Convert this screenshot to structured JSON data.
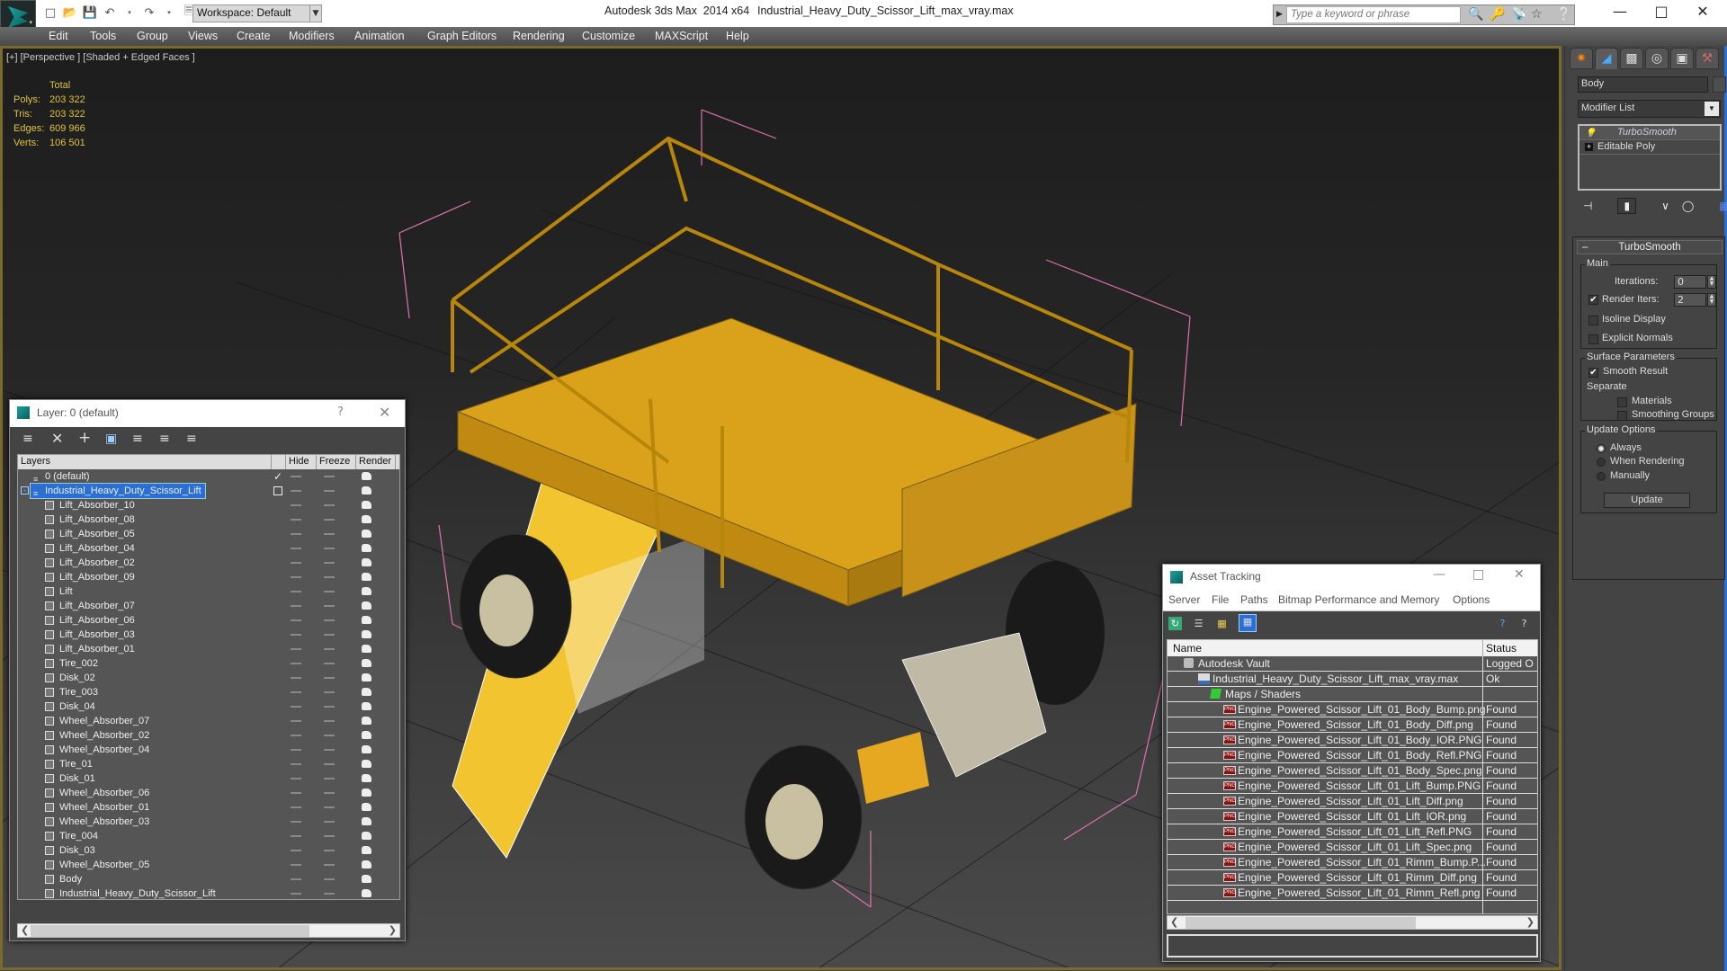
{
  "titlebar": {
    "app_title": "Autodesk 3ds Max  2014 x64",
    "file_name": "Industrial_Heavy_Duty_Scissor_Lift_max_vray.max",
    "workspace": "Workspace: Default",
    "search_placeholder": "Type a keyword or phrase",
    "quick_access_icons": [
      "new-file-icon",
      "open-folder-icon",
      "save-icon",
      "undo-icon",
      "redo-icon",
      "project-folder-icon"
    ],
    "info_icons": [
      "binoculars-icon",
      "key-icon",
      "satellite-icon",
      "star-icon",
      "help-icon"
    ]
  },
  "menubar": [
    "Edit",
    "Tools",
    "Group",
    "Views",
    "Create",
    "Modifiers",
    "Animation",
    "Graph Editors",
    "Rendering",
    "Customize",
    "MAXScript",
    "Help"
  ],
  "viewport": {
    "label": "[+] [Perspective ] [Shaded + Edged Faces ]",
    "stats": {
      "header": "Total",
      "rows": [
        {
          "key": "Polys:",
          "value": "203 322"
        },
        {
          "key": "Tris:",
          "value": "203 322"
        },
        {
          "key": "Edges:",
          "value": "609 966"
        },
        {
          "key": "Verts:",
          "value": "106 501"
        }
      ]
    }
  },
  "command_panel": {
    "tabs": [
      "create-tab",
      "modify-tab",
      "hierarchy-tab",
      "motion-tab",
      "display-tab",
      "utilities-tab"
    ],
    "object_name": "Body",
    "modifier_list": "Modifier List",
    "stack": [
      "TurboSmooth",
      "Editable Poly"
    ],
    "rollout_title": "TurboSmooth",
    "main_group": "Main",
    "iterations_label": "Iterations:",
    "iterations_value": "0",
    "render_iters_label": "Render Iters:",
    "render_iters_value": "2",
    "render_iters_checked": true,
    "isoline_label": "Isoline Display",
    "isoline_checked": false,
    "explicit_label": "Explicit Normals",
    "explicit_checked": false,
    "surface_group": "Surface Parameters",
    "smooth_result_label": "Smooth Result",
    "smooth_result_checked": true,
    "separate_label": "Separate",
    "materials_label": "Materials",
    "materials_checked": false,
    "smoothing_groups_label": "Smoothing Groups",
    "smoothing_groups_checked": false,
    "update_group": "Update Options",
    "update_options": [
      "Always",
      "When Rendering",
      "Manually"
    ],
    "update_selected": "Always",
    "update_button": "Update"
  },
  "layer_dialog": {
    "title": "Layer: 0 (default)",
    "help": "?",
    "columns": [
      "Layers",
      "",
      "Hide",
      "Freeze",
      "Render"
    ],
    "layers": [
      {
        "name": "0 (default)",
        "type": "layer",
        "current": true,
        "selected": false
      },
      {
        "name": "Industrial_Heavy_Duty_Scissor_Lift",
        "type": "layer",
        "current": false,
        "selected": true,
        "expanded": true
      }
    ],
    "objects": [
      "Lift_Absorber_10",
      "Lift_Absorber_08",
      "Lift_Absorber_05",
      "Lift_Absorber_04",
      "Lift_Absorber_02",
      "Lift_Absorber_09",
      "Lift",
      "Lift_Absorber_07",
      "Lift_Absorber_06",
      "Lift_Absorber_03",
      "Lift_Absorber_01",
      "Tire_002",
      "Disk_02",
      "Tire_003",
      "Disk_04",
      "Wheel_Absorber_07",
      "Wheel_Absorber_02",
      "Wheel_Absorber_04",
      "Tire_01",
      "Disk_01",
      "Wheel_Absorber_06",
      "Wheel_Absorber_01",
      "Wheel_Absorber_03",
      "Tire_004",
      "Disk_03",
      "Wheel_Absorber_05",
      "Body",
      "Industrial_Heavy_Duty_Scissor_Lift"
    ]
  },
  "asset_tracking": {
    "title": "Asset Tracking",
    "menu": [
      "Server",
      "File",
      "Paths",
      "Bitmap Performance and Memory",
      "Options"
    ],
    "columns": [
      "Name",
      "Status"
    ],
    "rows": [
      {
        "name": "Autodesk Vault",
        "status": "Logged O",
        "level": 0,
        "icon": "vault"
      },
      {
        "name": "Industrial_Heavy_Duty_Scissor_Lift_max_vray.max",
        "status": "Ok",
        "level": 1,
        "icon": "max"
      },
      {
        "name": "Maps / Shaders",
        "status": "",
        "level": 2,
        "icon": "maps"
      },
      {
        "name": "Engine_Powered_Scissor_Lift_01_Body_Bump.png",
        "status": "Found",
        "level": 3,
        "icon": "png"
      },
      {
        "name": "Engine_Powered_Scissor_Lift_01_Body_Diff.png",
        "status": "Found",
        "level": 3,
        "icon": "png"
      },
      {
        "name": "Engine_Powered_Scissor_Lift_01_Body_IOR.PNG",
        "status": "Found",
        "level": 3,
        "icon": "png"
      },
      {
        "name": "Engine_Powered_Scissor_Lift_01_Body_Refl.PNG",
        "status": "Found",
        "level": 3,
        "icon": "png"
      },
      {
        "name": "Engine_Powered_Scissor_Lift_01_Body_Spec.png",
        "status": "Found",
        "level": 3,
        "icon": "png"
      },
      {
        "name": "Engine_Powered_Scissor_Lift_01_Lift_Bump.PNG",
        "status": "Found",
        "level": 3,
        "icon": "png"
      },
      {
        "name": "Engine_Powered_Scissor_Lift_01_Lift_Diff.png",
        "status": "Found",
        "level": 3,
        "icon": "png"
      },
      {
        "name": "Engine_Powered_Scissor_Lift_01_Lift_IOR.png",
        "status": "Found",
        "level": 3,
        "icon": "png"
      },
      {
        "name": "Engine_Powered_Scissor_Lift_01_Lift_Refl.PNG",
        "status": "Found",
        "level": 3,
        "icon": "png"
      },
      {
        "name": "Engine_Powered_Scissor_Lift_01_Lift_Spec.png",
        "status": "Found",
        "level": 3,
        "icon": "png"
      },
      {
        "name": "Engine_Powered_Scissor_Lift_01_Rimm_Bump.P...",
        "status": "Found",
        "level": 3,
        "icon": "png"
      },
      {
        "name": "Engine_Powered_Scissor_Lift_01_Rimm_Diff.png",
        "status": "Found",
        "level": 3,
        "icon": "png"
      },
      {
        "name": "Engine_Powered_Scissor_Lift_01_Rimm_Refl.png",
        "status": "Found",
        "level": 3,
        "icon": "png"
      }
    ]
  },
  "colors": {
    "viewport_border": "#7a6a2c",
    "stats_text": "#e0c23b",
    "selection": "#2b6fd6",
    "model_yellow": "#d9a21a",
    "bbox_pink": "#e070b0"
  }
}
